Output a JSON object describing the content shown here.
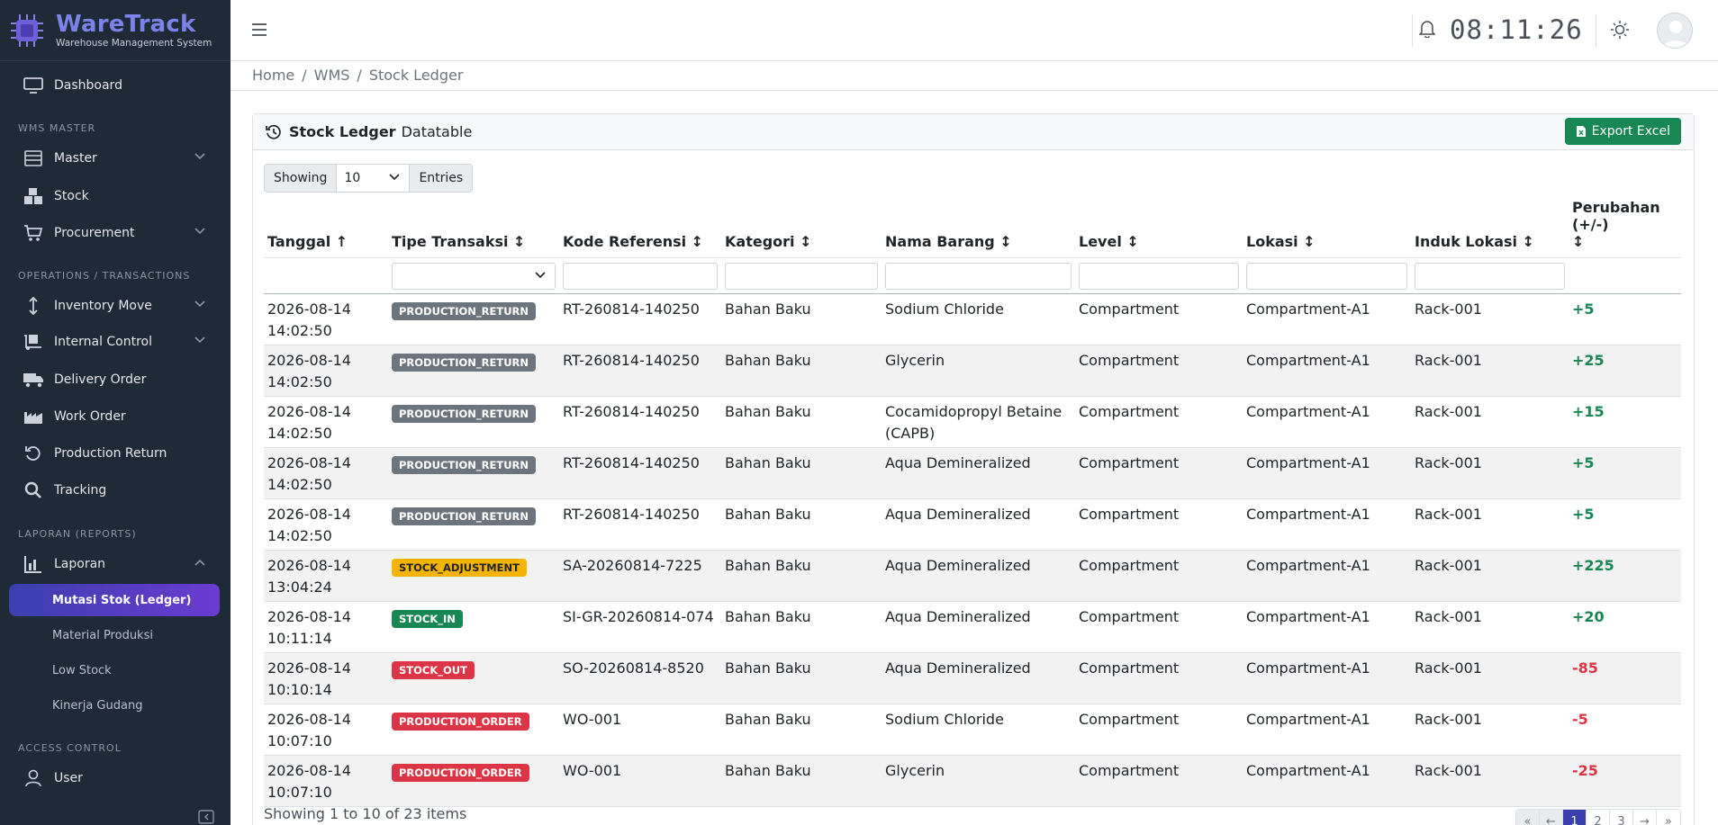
{
  "brand": {
    "title": "WareTrack",
    "subtitle": "Warehouse Management System"
  },
  "sidebar": {
    "dashboard": "Dashboard",
    "section_master": "WMS MASTER",
    "master": "Master",
    "stock": "Stock",
    "procurement": "Procurement",
    "section_ops": "OPERATIONS / TRANSACTIONS",
    "inventory_move": "Inventory Move",
    "internal_control": "Internal Control",
    "delivery_order": "Delivery Order",
    "work_order": "Work Order",
    "production_return": "Production Return",
    "tracking": "Tracking",
    "section_reports": "LAPORAN (REPORTS)",
    "laporan": "Laporan",
    "sub_mutasi": "Mutasi Stok (Ledger)",
    "sub_material": "Material Produksi",
    "sub_lowstock": "Low Stock",
    "sub_kinerja": "Kinerja Gudang",
    "section_access": "ACCESS CONTROL",
    "user": "User"
  },
  "topbar": {
    "clock": "08:11:26"
  },
  "breadcrumb": {
    "home": "Home",
    "sep": "/",
    "wms": "WMS",
    "current": "Stock Ledger"
  },
  "card": {
    "title_bold": "Stock Ledger",
    "title_rest": "Datatable",
    "export_label": "Export Excel"
  },
  "length": {
    "showing": "Showing",
    "value": "10",
    "entries": "Entries"
  },
  "table": {
    "headers": {
      "tanggal": "Tanggal ↑",
      "tipe": "Tipe Transaksi ↕",
      "kode": "Kode Referensi ↕",
      "kategori": "Kategori ↕",
      "nama": "Nama Barang ↕",
      "level": "Level ↕",
      "lokasi": "Lokasi ↕",
      "induk": "Induk Lokasi ↕",
      "perubahan": "Perubahan (+/-)",
      "perubahan_sort": "↕"
    },
    "rows": [
      {
        "date": "2026-08-14",
        "time": "14:02:50",
        "type": "PRODUCTION_RETURN",
        "type_color": "#6c757d",
        "ref": "RT-260814-140250",
        "kategori": "Bahan Baku",
        "nama": "Sodium Chloride",
        "level": "Compartment",
        "lokasi": "Compartment-A1",
        "induk": "Rack-001",
        "change": "+5"
      },
      {
        "date": "2026-08-14",
        "time": "14:02:50",
        "type": "PRODUCTION_RETURN",
        "type_color": "#6c757d",
        "ref": "RT-260814-140250",
        "kategori": "Bahan Baku",
        "nama": "Glycerin",
        "level": "Compartment",
        "lokasi": "Compartment-A1",
        "induk": "Rack-001",
        "change": "+25"
      },
      {
        "date": "2026-08-14",
        "time": "14:02:50",
        "type": "PRODUCTION_RETURN",
        "type_color": "#6c757d",
        "ref": "RT-260814-140250",
        "kategori": "Bahan Baku",
        "nama": "Cocamidopropyl Betaine (CAPB)",
        "level": "Compartment",
        "lokasi": "Compartment-A1",
        "induk": "Rack-001",
        "change": "+15"
      },
      {
        "date": "2026-08-14",
        "time": "14:02:50",
        "type": "PRODUCTION_RETURN",
        "type_color": "#6c757d",
        "ref": "RT-260814-140250",
        "kategori": "Bahan Baku",
        "nama": "Aqua Demineralized",
        "level": "Compartment",
        "lokasi": "Compartment-A1",
        "induk": "Rack-001",
        "change": "+5"
      },
      {
        "date": "2026-08-14",
        "time": "14:02:50",
        "type": "PRODUCTION_RETURN",
        "type_color": "#6c757d",
        "ref": "RT-260814-140250",
        "kategori": "Bahan Baku",
        "nama": "Aqua Demineralized",
        "level": "Compartment",
        "lokasi": "Compartment-A1",
        "induk": "Rack-001",
        "change": "+5"
      },
      {
        "date": "2026-08-14",
        "time": "13:04:24",
        "type": "STOCK_ADJUSTMENT",
        "type_color": "#f5b400",
        "ref": "SA-20260814-7225",
        "kategori": "Bahan Baku",
        "nama": "Aqua Demineralized",
        "level": "Compartment",
        "lokasi": "Compartment-A1",
        "induk": "Rack-001",
        "change": "+225"
      },
      {
        "date": "2026-08-14",
        "time": "10:11:14",
        "type": "STOCK_IN",
        "type_color": "#198754",
        "ref": "SI-GR-20260814-074",
        "kategori": "Bahan Baku",
        "nama": "Aqua Demineralized",
        "level": "Compartment",
        "lokasi": "Compartment-A1",
        "induk": "Rack-001",
        "change": "+20"
      },
      {
        "date": "2026-08-14",
        "time": "10:10:14",
        "type": "STOCK_OUT",
        "type_color": "#dc3545",
        "ref": "SO-20260814-8520",
        "kategori": "Bahan Baku",
        "nama": "Aqua Demineralized",
        "level": "Compartment",
        "lokasi": "Compartment-A1",
        "induk": "Rack-001",
        "change": "-85"
      },
      {
        "date": "2026-08-14",
        "time": "10:07:10",
        "type": "PRODUCTION_ORDER",
        "type_color": "#dc3545",
        "ref": "WO-001",
        "kategori": "Bahan Baku",
        "nama": "Sodium Chloride",
        "level": "Compartment",
        "lokasi": "Compartment-A1",
        "induk": "Rack-001",
        "change": "-5"
      },
      {
        "date": "2026-08-14",
        "time": "10:07:10",
        "type": "PRODUCTION_ORDER",
        "type_color": "#dc3545",
        "ref": "WO-001",
        "kategori": "Bahan Baku",
        "nama": "Glycerin",
        "level": "Compartment",
        "lokasi": "Compartment-A1",
        "induk": "Rack-001",
        "change": "-25"
      }
    ]
  },
  "footer": {
    "info": "Showing 1 to 10 of 23 items"
  },
  "pager": {
    "first": "«",
    "prev": "←",
    "p1": "1",
    "p2": "2",
    "p3": "3",
    "next": "→",
    "last": "»"
  },
  "colors": {
    "sidebar_bg": "#1f2a37",
    "accent": "#3b3fae",
    "success": "#198754",
    "danger": "#dc3545",
    "warning": "#f5b400"
  }
}
